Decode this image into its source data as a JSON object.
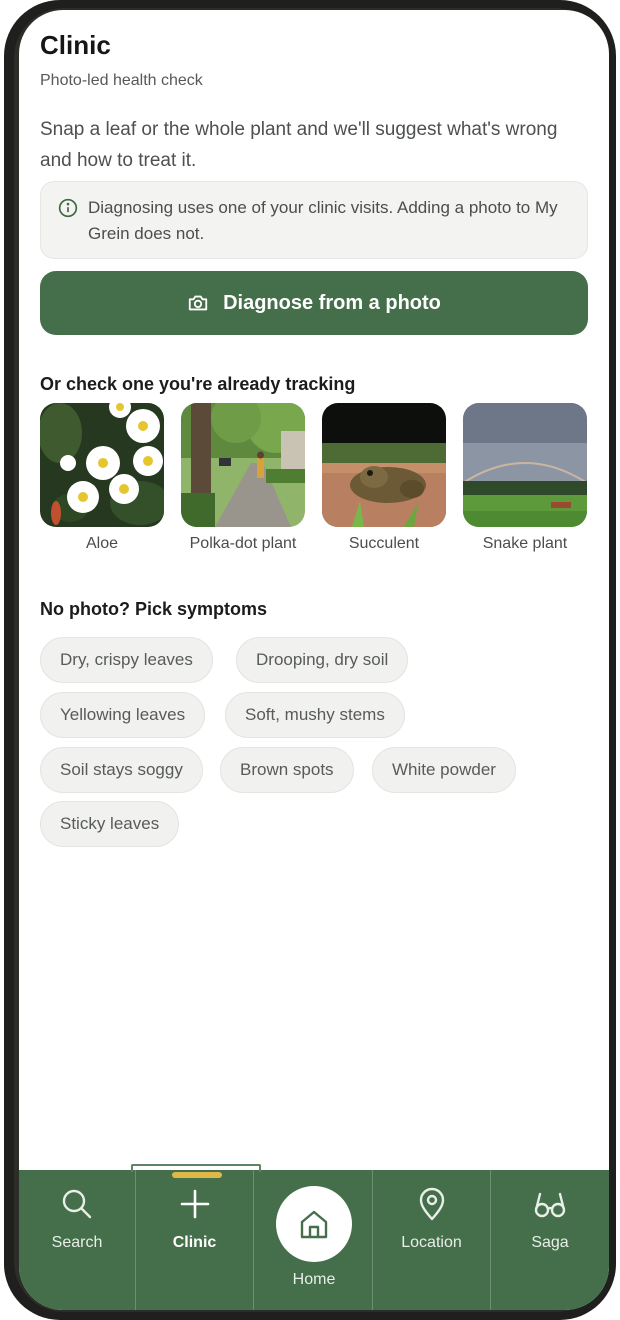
{
  "header": {
    "title": "Clinic",
    "subtitle": "Photo-led health check"
  },
  "intro": "Snap a leaf or the whole plant and we'll suggest what's wrong and how to treat it.",
  "notice": {
    "icon": "info-icon",
    "text": "Diagnosing uses one of your clinic visits. Adding a photo to My Grein does not."
  },
  "primary_action": {
    "icon": "camera-icon",
    "label": "Diagnose from a photo"
  },
  "tracked": {
    "heading": "Or check one you're already tracking",
    "plants": [
      {
        "name": "Aloe"
      },
      {
        "name": "Polka-dot plant"
      },
      {
        "name": "Succulent"
      },
      {
        "name": "Snake plant"
      }
    ]
  },
  "symptoms": {
    "heading": "No photo? Pick symptoms",
    "chips": [
      "Dry, crispy leaves",
      "Drooping, dry soil",
      "Yellowing leaves",
      "Soft, mushy stems",
      "Soil stays soggy",
      "Brown spots",
      "White powder",
      "Sticky leaves"
    ]
  },
  "tabbar": {
    "active": "Clinic",
    "tabs": [
      {
        "label": "Search",
        "icon": "search-icon"
      },
      {
        "label": "Clinic",
        "icon": "plus-icon"
      },
      {
        "label": "Home",
        "icon": "home-icon"
      },
      {
        "label": "Location",
        "icon": "location-pin-icon"
      },
      {
        "label": "Saga",
        "icon": "glasses-icon"
      }
    ]
  },
  "colors": {
    "brand_green": "#456e4a",
    "active_indicator": "#e0b84a",
    "chip_bg": "#f1f1ef",
    "notice_bg": "#f3f3f1"
  }
}
